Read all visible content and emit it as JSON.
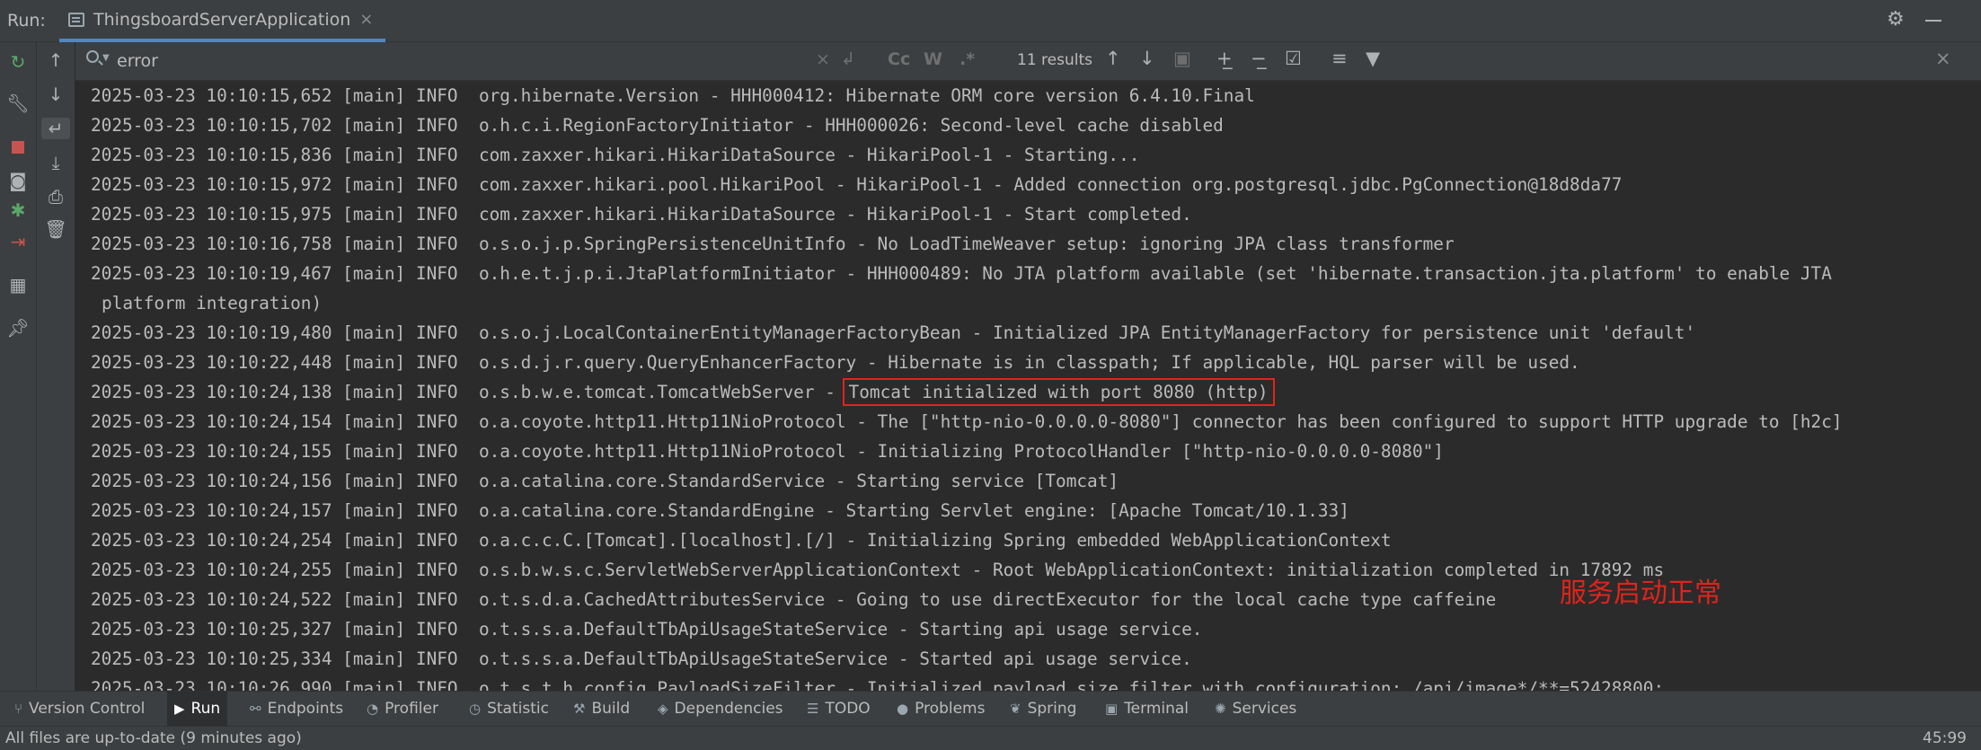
{
  "header": {
    "run_label": "Run:",
    "tab_title": "ThingsboardServerApplication",
    "tab_close": "×"
  },
  "search": {
    "query": "error",
    "match_case": "Cc",
    "words": "W",
    "regex": ".*",
    "results": "11 results",
    "close": "×"
  },
  "console": {
    "lines": [
      "2025-03-23 10:10:15,652 [main] INFO  org.hibernate.Version - HHH000412: Hibernate ORM core version 6.4.10.Final",
      "2025-03-23 10:10:15,702 [main] INFO  o.h.c.i.RegionFactoryInitiator - HHH000026: Second-level cache disabled",
      "2025-03-23 10:10:15,836 [main] INFO  com.zaxxer.hikari.HikariDataSource - HikariPool-1 - Starting...",
      "2025-03-23 10:10:15,972 [main] INFO  com.zaxxer.hikari.pool.HikariPool - HikariPool-1 - Added connection org.postgresql.jdbc.PgConnection@18d8da77",
      "2025-03-23 10:10:15,975 [main] INFO  com.zaxxer.hikari.HikariDataSource - HikariPool-1 - Start completed.",
      "2025-03-23 10:10:16,758 [main] INFO  o.s.o.j.p.SpringPersistenceUnitInfo - No LoadTimeWeaver setup: ignoring JPA class transformer",
      "2025-03-23 10:10:19,467 [main] INFO  o.h.e.t.j.p.i.JtaPlatformInitiator - HHH000489: No JTA platform available (set 'hibernate.transaction.jta.platform' to enable JTA",
      "platform integration)",
      "2025-03-23 10:10:19,480 [main] INFO  o.s.o.j.LocalContainerEntityManagerFactoryBean - Initialized JPA EntityManagerFactory for persistence unit 'default'",
      "2025-03-23 10:10:22,448 [main] INFO  o.s.d.j.r.query.QueryEnhancerFactory - Hibernate is in classpath; If applicable, HQL parser will be used.",
      "2025-03-23 10:10:24,138 [main] INFO  o.s.b.w.e.tomcat.TomcatWebServer - ",
      "2025-03-23 10:10:24,154 [main] INFO  o.a.coyote.http11.Http11NioProtocol - The [\"http-nio-0.0.0.0-8080\"] connector has been configured to support HTTP upgrade to [h2c]",
      "2025-03-23 10:10:24,155 [main] INFO  o.a.coyote.http11.Http11NioProtocol - Initializing ProtocolHandler [\"http-nio-0.0.0.0-8080\"]",
      "2025-03-23 10:10:24,156 [main] INFO  o.a.catalina.core.StandardService - Starting service [Tomcat]",
      "2025-03-23 10:10:24,157 [main] INFO  o.a.catalina.core.StandardEngine - Starting Servlet engine: [Apache Tomcat/10.1.33]",
      "2025-03-23 10:10:24,254 [main] INFO  o.a.c.c.C.[Tomcat].[localhost].[/] - Initializing Spring embedded WebApplicationContext",
      "2025-03-23 10:10:24,255 [main] INFO  o.s.b.w.s.c.ServletWebServerApplicationContext - Root WebApplicationContext: initialization completed in 17892 ms",
      "2025-03-23 10:10:24,522 [main] INFO  o.t.s.d.a.CachedAttributesService - Going to use directExecutor for the local cache type caffeine",
      "2025-03-23 10:10:25,327 [main] INFO  o.t.s.s.a.DefaultTbApiUsageStateService - Starting api usage service.",
      "2025-03-23 10:10:25,334 [main] INFO  o.t.s.s.a.DefaultTbApiUsageStateService - Started api usage service.",
      "2025-03-23 10:10:26,990 [main] INFO  o.t.s.t.h.config.PayloadSizeFilter - Initialized payload size filter with configuration: /api/image*/**=52428800;"
    ],
    "highlight": "Tomcat initialized with port 8080 (http)",
    "annotation": "服务启动正常",
    "annotation_color": "#e0241b"
  },
  "toolwindows": [
    {
      "label": "Version Control",
      "icon": "branch-icon"
    },
    {
      "label": "Run",
      "icon": "play-icon"
    },
    {
      "label": "Endpoints",
      "icon": "endpoints-icon"
    },
    {
      "label": "Profiler",
      "icon": "profiler-icon"
    },
    {
      "label": "Statistic",
      "icon": "statistic-icon"
    },
    {
      "label": "Build",
      "icon": "hammer-icon"
    },
    {
      "label": "Dependencies",
      "icon": "layers-icon"
    },
    {
      "label": "TODO",
      "icon": "list-icon"
    },
    {
      "label": "Problems",
      "icon": "info-icon"
    },
    {
      "label": "Spring",
      "icon": "leaf-icon"
    },
    {
      "label": "Terminal",
      "icon": "terminal-icon"
    },
    {
      "label": "Services",
      "icon": "services-icon"
    }
  ],
  "status": {
    "text": "All files are up-to-date (9 minutes ago)",
    "position": "45:99"
  }
}
